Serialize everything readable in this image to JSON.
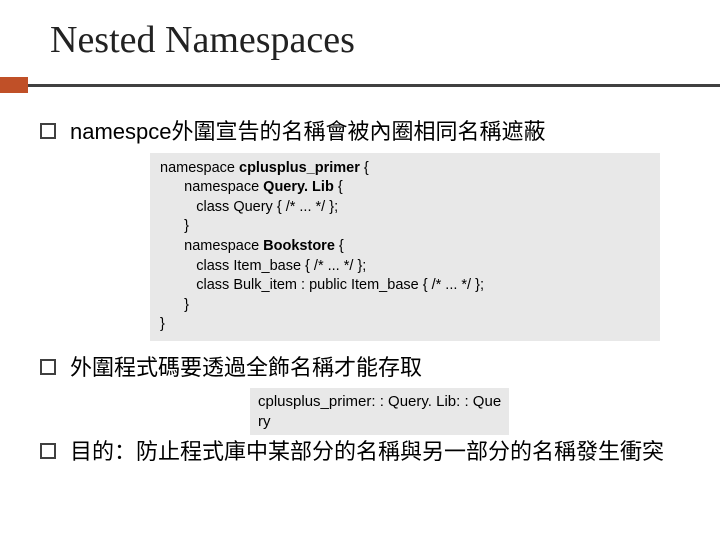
{
  "title": "Nested Namespaces",
  "bullets": {
    "b1": "namespce外圍宣告的名稱會被內圈相同名稱遮蔽",
    "b2": "外圍程式碼要透過全飾名稱才能存取",
    "b3": "目的：防止程式庫中某部分的名稱與另一部分的名稱發生衝突"
  },
  "code1": {
    "l1a": "namespace ",
    "l1b": "cplusplus_primer",
    "l1c": " {",
    "l2a": "      namespace ",
    "l2b": "Query. Lib",
    "l2c": " {",
    "l3": "         class Query { /* ... */ };",
    "l4": "      }",
    "l5a": "      namespace ",
    "l5b": "Bookstore",
    "l5c": " {",
    "l6": "         class Item_base { /* ... */ };",
    "l7": "         class Bulk_item : public Item_base { /* ... */ };",
    "l8": "      }",
    "l9": "}"
  },
  "code2": {
    "l1": "cplusplus_primer: : Query. Lib: : Que",
    "l2": "ry"
  }
}
